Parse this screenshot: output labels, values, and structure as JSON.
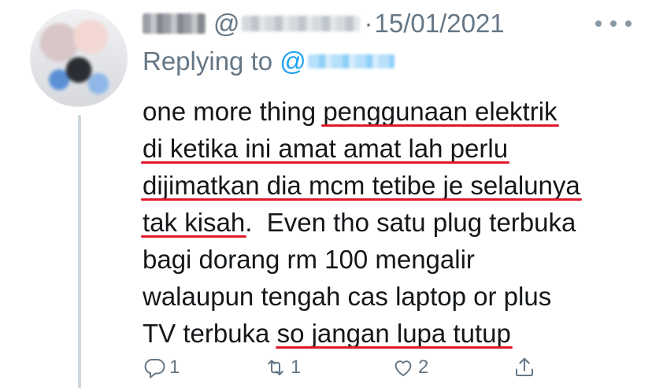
{
  "tweet": {
    "author_at": "@",
    "date": "15/01/2021",
    "replying_label": "Replying to",
    "replying_at": "@",
    "text_lines": [
      [
        {
          "t": "one more thing ",
          "u": false
        },
        {
          "t": "penggunaan elektrik",
          "u": true
        }
      ],
      [
        {
          "t": "di ketika ini amat amat lah perlu",
          "u": true
        }
      ],
      [
        {
          "t": "dijimatkan dia mcm tetibe je selalunya",
          "u": true
        }
      ],
      [
        {
          "t": "tak kisah",
          "u": true
        },
        {
          "t": ".  Even tho satu plug terbuka",
          "u": false
        }
      ],
      [
        {
          "t": "bagi dorang rm 100 mengalir",
          "u": false
        }
      ],
      [
        {
          "t": "walaupun tengah cas laptop or plus",
          "u": false
        }
      ],
      [
        {
          "t": "TV terbuka ",
          "u": false
        },
        {
          "t": "so jangan lupa tutup",
          "u": true
        }
      ]
    ]
  },
  "actions": {
    "reply_count": "1",
    "retweet_count": "1",
    "like_count": "2"
  },
  "icons": {
    "more": "more-horizontal-icon",
    "reply": "reply-icon",
    "retweet": "retweet-icon",
    "like": "heart-icon",
    "share": "share-icon"
  },
  "colors": {
    "underline": "#e0192a",
    "mention": "#1da1f2",
    "muted": "#657786"
  }
}
